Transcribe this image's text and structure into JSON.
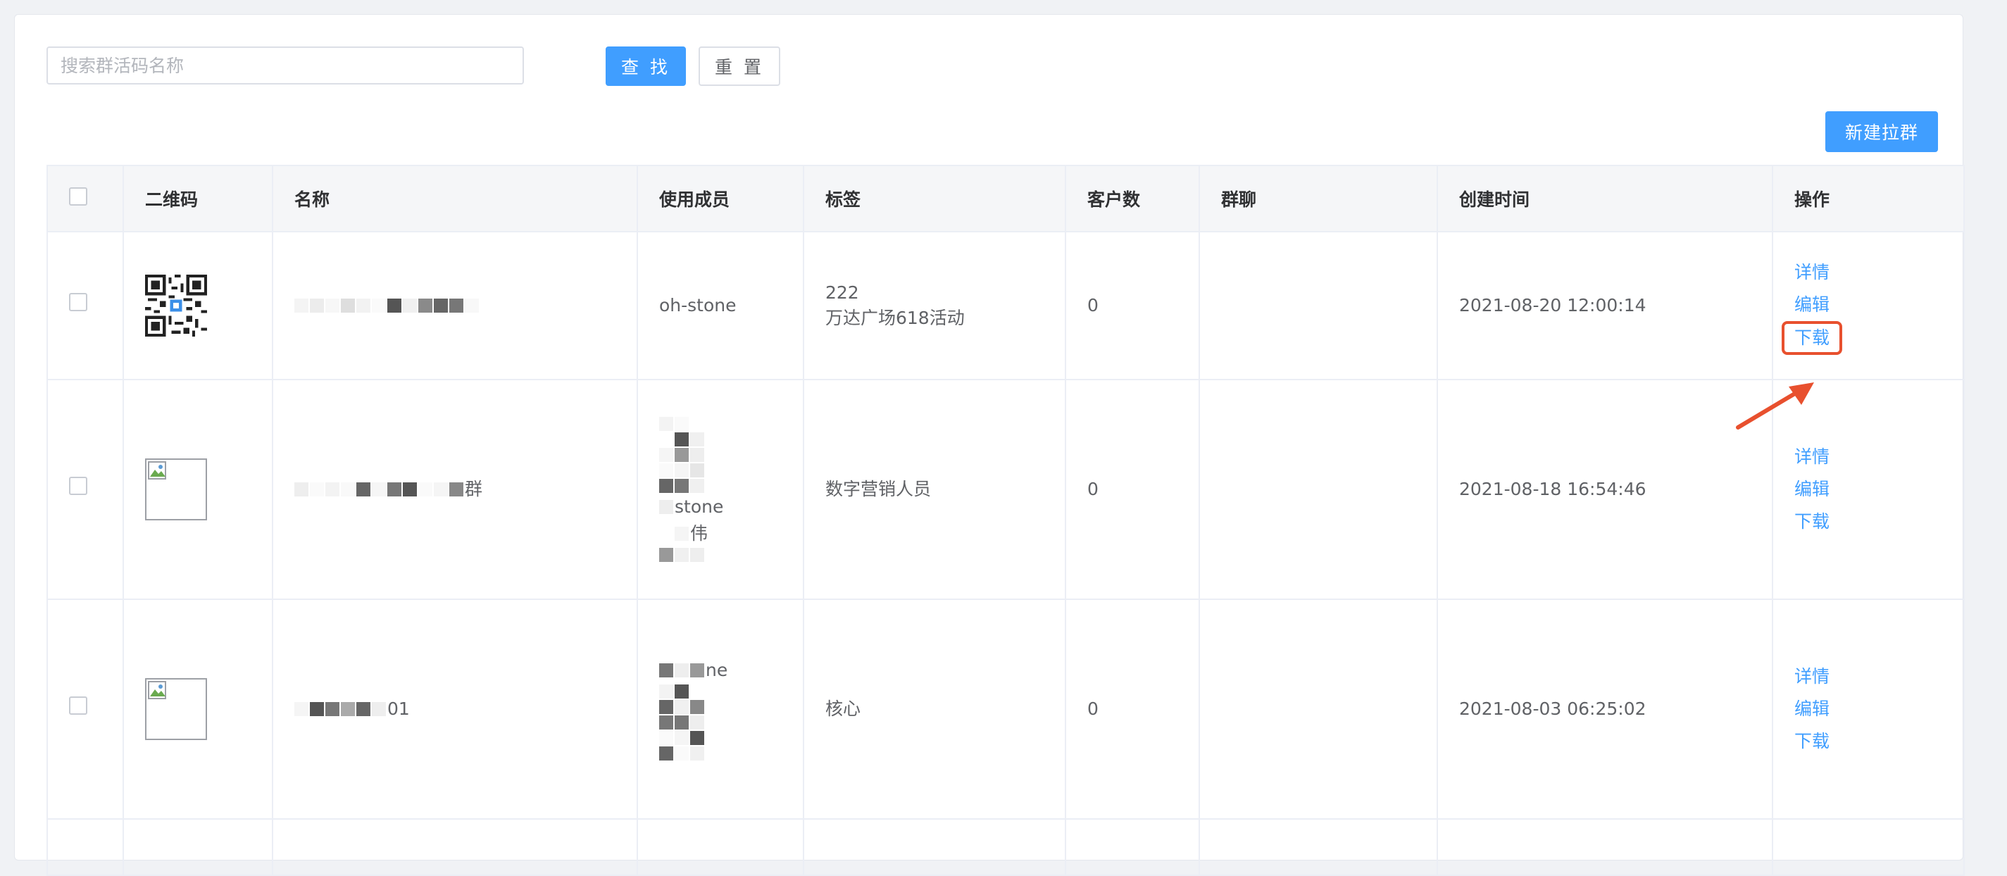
{
  "search": {
    "placeholder": "搜索群活码名称",
    "value": ""
  },
  "toolbar": {
    "search_label": "查 找",
    "reset_label": "重 置",
    "create_label": "新建拉群"
  },
  "table": {
    "columns": [
      "二维码",
      "名称",
      "使用成员",
      "标签",
      "客户数",
      "群聊",
      "创建时间",
      "操作"
    ],
    "rows": [
      {
        "name_visible": "",
        "members": [
          "oh-stone"
        ],
        "tags": [
          "222",
          "万达广场618活动"
        ],
        "customers": "0",
        "group_chat": "",
        "created": "2021-08-20 12:00:14",
        "actions": [
          "详情",
          "编辑",
          "下载"
        ]
      },
      {
        "name_visible": "群",
        "members": [
          "stone",
          "伟"
        ],
        "tags": [
          "数字营销人员"
        ],
        "customers": "0",
        "group_chat": "",
        "created": "2021-08-18 16:54:46",
        "actions": [
          "详情",
          "编辑",
          "下载"
        ]
      },
      {
        "name_visible": "01",
        "members": [
          "ne"
        ],
        "tags": [
          "核心"
        ],
        "customers": "0",
        "group_chat": "",
        "created": "2021-08-03 06:25:02",
        "actions": [
          "详情",
          "编辑",
          "下载"
        ]
      }
    ]
  },
  "colors": {
    "primary": "#409eff",
    "highlight": "#e8502e",
    "header_bg": "#f5f6f8",
    "border": "#ebeef5"
  },
  "icons": {
    "qr": "qr-code-icon",
    "broken_image": "broken-image-icon",
    "arrow": "annotation-arrow-icon"
  }
}
